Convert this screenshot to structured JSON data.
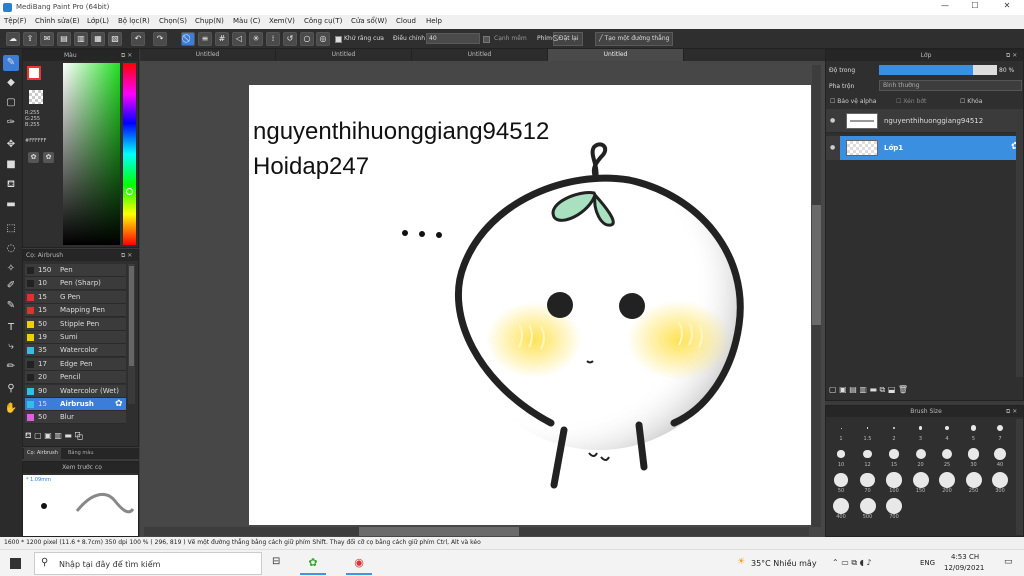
{
  "title": "MediBang Paint Pro (64bit)",
  "window_controls": {
    "minimize": "—",
    "maximize": "☐",
    "close": "✕"
  },
  "menu": [
    "Tệp(F)",
    "Chỉnh sửa(E)",
    "Lớp(L)",
    "Bộ lọc(R)",
    "Chọn(S)",
    "Chụp(N)",
    "Màu (C)",
    "Xem(V)",
    "Công cụ(T)",
    "Cửa sổ(W)",
    "Cloud",
    "Help"
  ],
  "toolbar": {
    "antialias_label": "Khử răng cưa",
    "adjust_label": "Điều chỉnh",
    "adjust_value": "40",
    "edge_label": "Cạnh mềm",
    "pen_label": "Phím",
    "reset_label": "Đặt lại",
    "straight_label": "Tạo một đường thẳng"
  },
  "tabs": [
    "Untitled",
    "Untitled",
    "Untitled",
    "Untitled"
  ],
  "color_panel": {
    "title": "Màu",
    "r": "R:255",
    "g": "G:255",
    "b": "B:255",
    "hex": "#FFFFFF"
  },
  "brush_panel": {
    "title": "Cọ: Airbrush",
    "brushes": [
      {
        "size": "150",
        "name": "Pen",
        "color": "#222222"
      },
      {
        "size": "10",
        "name": "Pen (Sharp)",
        "color": "#222222"
      },
      {
        "size": "15",
        "name": "G Pen",
        "color": "#e03030"
      },
      {
        "size": "15",
        "name": "Mapping Pen",
        "color": "#e03030"
      },
      {
        "size": "50",
        "name": "Stipple Pen",
        "color": "#f0d000"
      },
      {
        "size": "19",
        "name": "Sumi",
        "color": "#f0d000"
      },
      {
        "size": "35",
        "name": "Watercolor",
        "color": "#30c0e0"
      },
      {
        "size": "17",
        "name": "Edge Pen",
        "color": "#222222"
      },
      {
        "size": "20",
        "name": "Pencil",
        "color": "#222222"
      },
      {
        "size": "90",
        "name": "Watercolor (Wet)",
        "color": "#30c0e0"
      },
      {
        "size": "15",
        "name": "Airbrush",
        "color": "#30c0e0",
        "selected": true
      },
      {
        "size": "50",
        "name": "Blur",
        "color": "#e060e0"
      }
    ],
    "tab1": "Cọ: Airbrush",
    "tab2": "Bảng màu"
  },
  "preview": {
    "title": "Xem trước cọ",
    "size": "* 1.09mm"
  },
  "canvas": {
    "line1": "nguyenthihuonggiang94512",
    "line2": "Hoidap247"
  },
  "layer_panel": {
    "title": "Lớp",
    "opacity_label": "Độ trong",
    "opacity_value": "80 %",
    "opacity": 0.8,
    "blend_label": "Pha trộn",
    "blend_value": "Bình thường",
    "protect_alpha": "Bảo vệ alpha",
    "clip": "Xén bớt",
    "lock": "Khóa",
    "layers": [
      {
        "name": "nguyenthihuonggiang94512",
        "selected": false
      },
      {
        "name": "Lớp1",
        "selected": true
      }
    ]
  },
  "brush_size": {
    "title": "Brush Size",
    "sizes": [
      "1",
      "1.5",
      "2",
      "3",
      "4",
      "5",
      "7",
      "10",
      "12",
      "15",
      "20",
      "25",
      "30",
      "40",
      "50",
      "70",
      "100",
      "150",
      "200",
      "250",
      "300",
      "400",
      "500",
      "700"
    ]
  },
  "status": {
    "dims": "1600 * 1200 pixel",
    "phys": "(11.6 * 8.7cm)",
    "dpi": "350 dpi",
    "zoom": "100 %",
    "coords": "( 296, 819 )",
    "hint": "Vẽ một đường thẳng bằng cách giữ phím Shift. Thay đổi cỡ cọ bằng cách giữ phím Ctrl, Alt và kéo"
  },
  "taskbar": {
    "search_placeholder": "Nhập tại đây để tìm kiếm",
    "weather": "35°C  Nhiều mây",
    "lang": "ENG",
    "time": "4:53 CH",
    "date": "12/09/2021"
  }
}
